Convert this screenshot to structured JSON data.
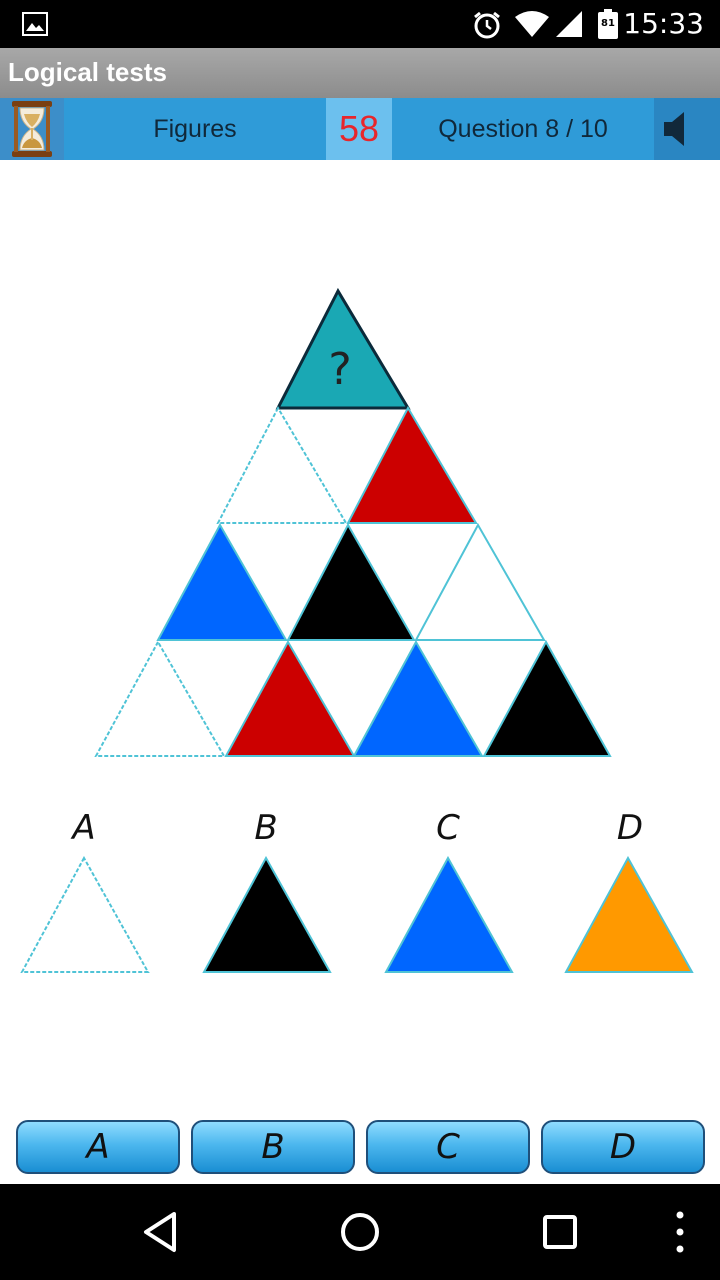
{
  "status_bar": {
    "battery_level": "81",
    "time": "15:33"
  },
  "app": {
    "title": "Logical tests"
  },
  "toolbar": {
    "category": "Figures",
    "timer_value": "58",
    "question_counter": "Question 8 / 10",
    "icons": [
      "hourglass-icon",
      "speaker-icon"
    ]
  },
  "puzzle": {
    "question_mark": "?",
    "top_cell": {
      "fill": "#1aa8b4",
      "label": "?"
    },
    "rows": [
      [
        "#ffffff",
        "#cc0000"
      ],
      [
        "#0066ff",
        "#000000",
        "#ffffff"
      ],
      [
        "#ffffff",
        "#cc0000",
        "#0066ff",
        "#000000"
      ]
    ]
  },
  "options": [
    {
      "letter": "A",
      "fill": "#ffffff"
    },
    {
      "letter": "B",
      "fill": "#000000"
    },
    {
      "letter": "C",
      "fill": "#0066ff"
    },
    {
      "letter": "D",
      "fill": "#ff9900"
    }
  ],
  "answer_buttons": [
    "A",
    "B",
    "C",
    "D"
  ],
  "colors": {
    "toolbar_blue": "#2f9bd8",
    "timer_red": "#e8262b",
    "outline_cyan": "#4fc3d6"
  }
}
